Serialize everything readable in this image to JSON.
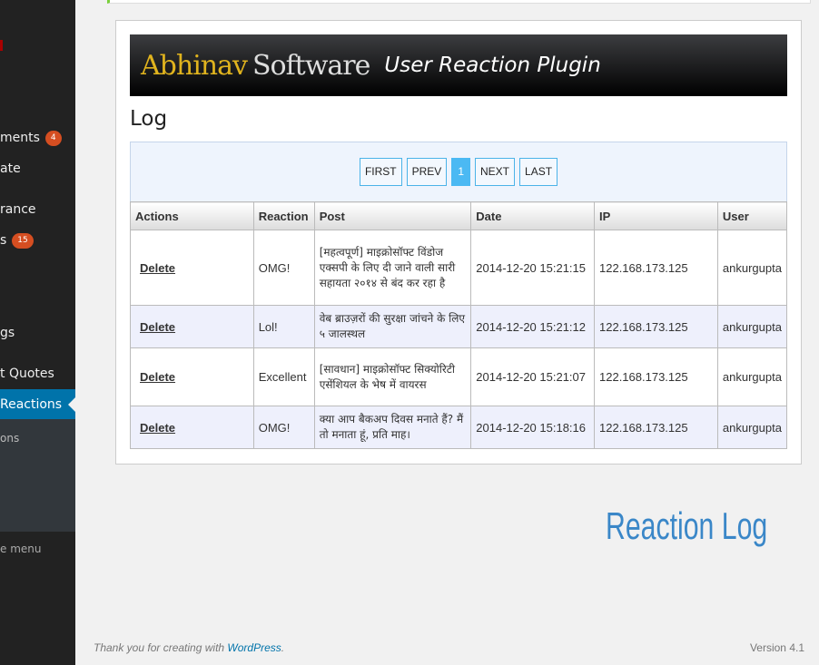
{
  "sidebar": {
    "items": [
      {
        "label": "ments",
        "badge": "4"
      },
      {
        "label": "ate"
      },
      {
        "label": "rance"
      },
      {
        "label": "s",
        "badge": "15"
      },
      {
        "label": "gs"
      },
      {
        "label": "t Quotes"
      },
      {
        "label": "Reactions"
      },
      {
        "label": "ons"
      }
    ],
    "collapse": "e menu"
  },
  "banner": {
    "brand1": "Abhinav",
    "brand2": "Software",
    "plugin": "User Reaction Plugin"
  },
  "page_title": "Log",
  "pager": {
    "first": "FIRST",
    "prev": "PREV",
    "current": "1",
    "next": "NEXT",
    "last": "LAST"
  },
  "table": {
    "headers": [
      "Actions",
      "Reaction",
      "Post",
      "Date",
      "IP",
      "User"
    ],
    "rows": [
      {
        "action": "Delete",
        "reaction": "OMG!",
        "post": "[महत्वपूर्ण] माइक्रोसॉफ्ट विंडोज एक्सपी के लिए दी जाने वाली सारी सहायता २०१४ से बंद कर रहा है",
        "date": "2014-12-20 15:21:15",
        "ip": "122.168.173.125",
        "user": "ankurgupta"
      },
      {
        "action": "Delete",
        "reaction": "Lol!",
        "post": "वेब ब्राउज़रों की सुरक्षा जांचने के लिए ५ जालस्थल",
        "date": "2014-12-20 15:21:12",
        "ip": "122.168.173.125",
        "user": "ankurgupta"
      },
      {
        "action": "Delete",
        "reaction": "Excellent",
        "post": "[सावधान] माइक्रोसॉफ्ट सिक्योरिटी एसेंशियल के भेष में वायरस",
        "date": "2014-12-20 15:21:07",
        "ip": "122.168.173.125",
        "user": "ankurgupta"
      },
      {
        "action": "Delete",
        "reaction": "OMG!",
        "post": "क्या आप बैकअप दिवस मनाते हैं? मैं तो मनाता हूं, प्रति माह।",
        "date": "2014-12-20 15:18:16",
        "ip": "122.168.173.125",
        "user": "ankurgupta"
      }
    ]
  },
  "caption": "Reaction Log",
  "footer": {
    "text": "Thank you for creating with ",
    "link": "WordPress",
    "end": ".",
    "version": "Version 4.1"
  },
  "colors": {
    "accent": "#0073aa",
    "badge": "#d54e21",
    "caption": "#3a87c8"
  }
}
